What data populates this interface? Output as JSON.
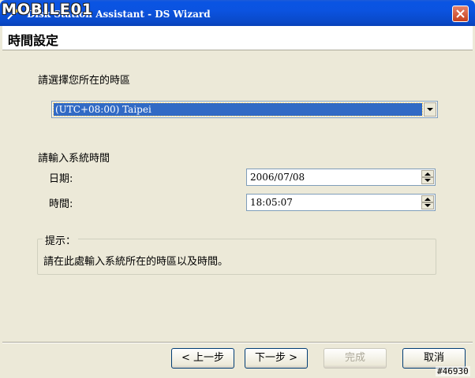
{
  "window": {
    "title": "Disk Station Assistant - DS Wizard",
    "watermark": "MOBILE01"
  },
  "header": {
    "title": "時間設定"
  },
  "timezone": {
    "prompt": "請選擇您所在的時區",
    "selected": "(UTC+08:00) Taipei"
  },
  "system_time": {
    "prompt": "請輸入系統時間",
    "date_label": "日期:",
    "date_value": "2006/07/08",
    "time_label": "時間:",
    "time_value": "18:05:07"
  },
  "hint": {
    "title": "提示：",
    "text": "請在此處輸入系統所在的時區以及時間。"
  },
  "buttons": {
    "back": "< 上一步",
    "next": "下一步 >",
    "finish": "完成",
    "cancel": "取消"
  },
  "corner_tag": "#46930"
}
